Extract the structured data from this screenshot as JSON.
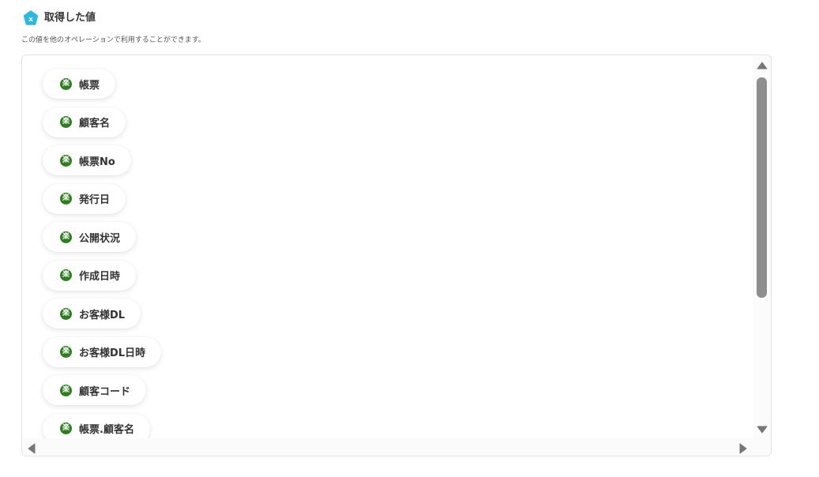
{
  "header": {
    "title": "取得した値",
    "subtitle": "この値を他のオペレーションで利用することができます。",
    "icon": "variable-x-hexagon-icon",
    "icon_color": "#2bb8e0"
  },
  "items_icon": {
    "name": "rakuten-raku-icon",
    "glyph": "楽",
    "color": "#2e7d1e"
  },
  "items": [
    {
      "label": "帳票"
    },
    {
      "label": "顧客名"
    },
    {
      "label": "帳票No"
    },
    {
      "label": "発行日"
    },
    {
      "label": "公開状況"
    },
    {
      "label": "作成日時"
    },
    {
      "label": "お客様DL"
    },
    {
      "label": "お客様DL日時"
    },
    {
      "label": "顧客コード"
    },
    {
      "label": "帳票.顧客名"
    }
  ],
  "scrollbars": {
    "vertical": {
      "position": 0.0,
      "visible_fraction": 0.58
    },
    "horizontal": {
      "position": 0.0
    }
  }
}
